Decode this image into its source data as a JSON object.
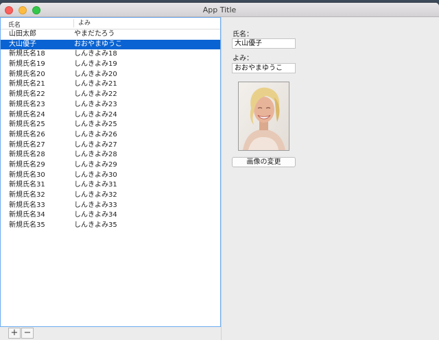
{
  "window": {
    "title": "App Title"
  },
  "table": {
    "columns": [
      "氏名",
      "よみ"
    ],
    "rows": [
      {
        "name": "山田太郎",
        "yomi": "やまだたろう"
      },
      {
        "name": "大山優子",
        "yomi": "おおやまゆうこ"
      },
      {
        "name": "新規氏名18",
        "yomi": "しんきよみ18"
      },
      {
        "name": "新規氏名19",
        "yomi": "しんきよみ19"
      },
      {
        "name": "新規氏名20",
        "yomi": "しんきよみ20"
      },
      {
        "name": "新規氏名21",
        "yomi": "しんきよみ21"
      },
      {
        "name": "新規氏名22",
        "yomi": "しんきよみ22"
      },
      {
        "name": "新規氏名23",
        "yomi": "しんきよみ23"
      },
      {
        "name": "新規氏名24",
        "yomi": "しんきよみ24"
      },
      {
        "name": "新規氏名25",
        "yomi": "しんきよみ25"
      },
      {
        "name": "新規氏名26",
        "yomi": "しんきよみ26"
      },
      {
        "name": "新規氏名27",
        "yomi": "しんきよみ27"
      },
      {
        "name": "新規氏名28",
        "yomi": "しんきよみ28"
      },
      {
        "name": "新規氏名29",
        "yomi": "しんきよみ29"
      },
      {
        "name": "新規氏名30",
        "yomi": "しんきよみ30"
      },
      {
        "name": "新規氏名31",
        "yomi": "しんきよみ31"
      },
      {
        "name": "新規氏名32",
        "yomi": "しんきよみ32"
      },
      {
        "name": "新規氏名33",
        "yomi": "しんきよみ33"
      },
      {
        "name": "新規氏名34",
        "yomi": "しんきよみ34"
      },
      {
        "name": "新規氏名35",
        "yomi": "しんきよみ35"
      }
    ],
    "selected_index": 1
  },
  "bottom_bar": {
    "add_label": "+",
    "remove_label": "−"
  },
  "detail": {
    "name_label": "氏名：",
    "name_value": "大山優子",
    "yomi_label": "よみ：",
    "yomi_value": "おおやまゆうこ",
    "change_image_label": "画像の変更"
  },
  "colors": {
    "selection": "#0a63d2",
    "focus_ring": "#6aaaf0"
  }
}
